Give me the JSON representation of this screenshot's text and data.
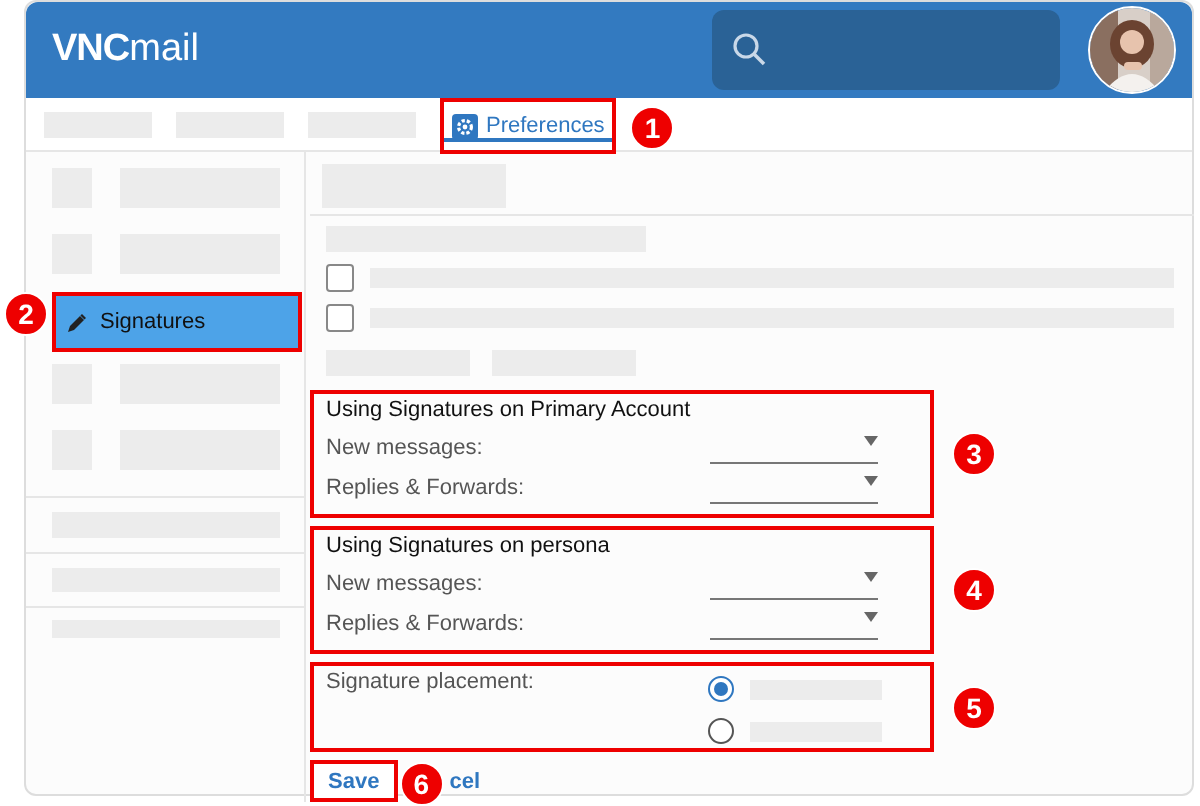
{
  "header": {
    "logo_bold": "VNC",
    "logo_light": "mail"
  },
  "tabs": [
    {
      "label": "Preferences",
      "selected": true,
      "callout": "1"
    }
  ],
  "sidebar": {
    "items": [
      {
        "label": "Signatures",
        "selected": true,
        "callout": "2"
      }
    ]
  },
  "checks": [
    {
      "checked": false
    },
    {
      "checked": false
    }
  ],
  "sections": [
    {
      "title": "Using Signatures on Primary Account",
      "callout": "3",
      "fields": [
        {
          "label": "New messages:"
        },
        {
          "label": "Replies & Forwards:"
        }
      ]
    },
    {
      "title": "Using Signatures on persona",
      "callout": "4",
      "fields": [
        {
          "label": "New messages:"
        },
        {
          "label": "Replies & Forwards:"
        }
      ]
    }
  ],
  "placement": {
    "label": "Signature placement:",
    "callout": "5",
    "options": [
      {
        "selected": true
      },
      {
        "selected": false
      }
    ]
  },
  "buttons": {
    "save": {
      "label": "Save",
      "callout": "6"
    },
    "cancel": {
      "label": "cel"
    }
  }
}
